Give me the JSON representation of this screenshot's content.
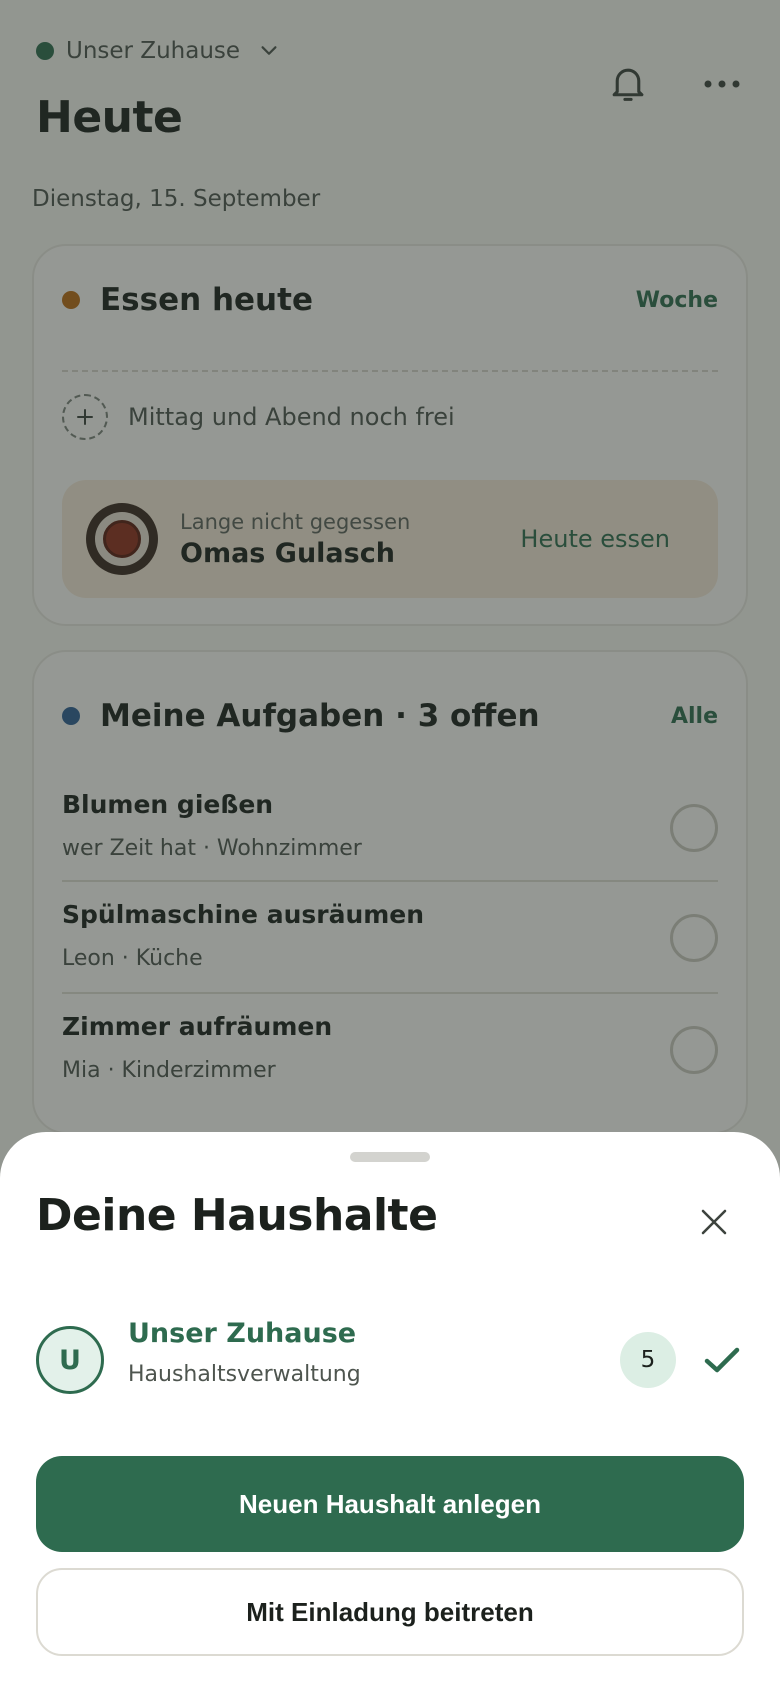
{
  "header": {
    "household_name": "Unser Zuhause",
    "title": "Heute",
    "date": "Dienstag, 15. September",
    "icons": [
      "bell-icon",
      "more-icon",
      "chevron-down-icon"
    ]
  },
  "meals_card": {
    "title": "Essen heute",
    "link": "Woche",
    "empty_text": "Mittag und Abend noch frei",
    "suggestion": {
      "subtitle": "Lange nicht gegessen",
      "name": "Omas Gulasch",
      "cta": "Heute essen"
    }
  },
  "tasks_card": {
    "title": "Meine Aufgaben · 3 offen",
    "link": "Alle",
    "items": [
      {
        "name": "Blumen gießen",
        "meta": "wer Zeit hat · Wohnzimmer"
      },
      {
        "name": "Spülmaschine ausräumen",
        "meta": "Leon · Küche"
      },
      {
        "name": "Zimmer aufräumen",
        "meta": "Mia · Kinderzimmer"
      }
    ]
  },
  "sheet": {
    "title": "Deine Haushalte",
    "households": [
      {
        "initial": "U",
        "name": "Unser Zuhause",
        "role": "Haushaltsverwaltung",
        "members": "5",
        "selected": true
      }
    ],
    "primary_button": "Neuen Haushalt anlegen",
    "secondary_button": "Mit Einladung beitreten"
  },
  "colors": {
    "accent_green": "#2e6b4f",
    "meal_dot": "#b86a14",
    "task_dot": "#2e5f95",
    "suggestion_bg": "#f4e7d6"
  }
}
